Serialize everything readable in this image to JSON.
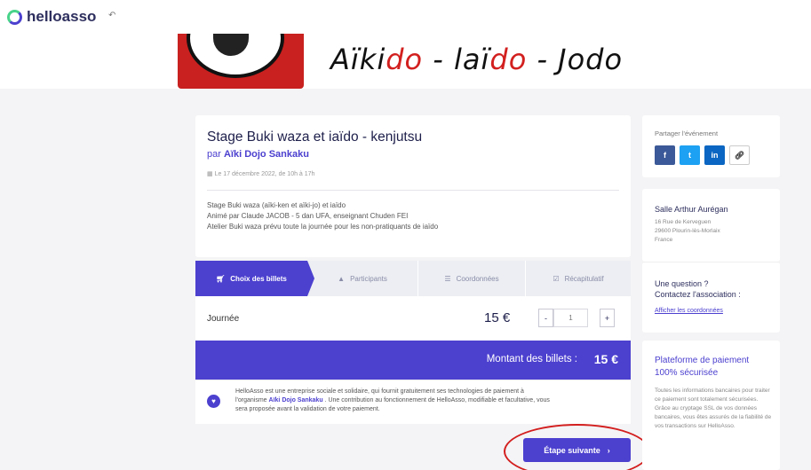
{
  "header": {
    "brand": "helloasso",
    "back_icon": "back-arrow-icon"
  },
  "banner": {
    "title_part1": "Aïki",
    "title_part2": "do",
    "title_sep1": " - ",
    "title_part3": "laï",
    "title_part4": "do",
    "title_sep2": " - ",
    "title_part5": "Jodo"
  },
  "event": {
    "title": "Stage Buki waza et iaïdo - kenjutsu",
    "by_prefix": "par ",
    "organizer": "Aïki Dojo Sankaku",
    "date": "Le 17 décembre 2022, de 10h à 17h",
    "description": [
      "Stage Buki waza (aïki-ken et aïki-jo) et iaïdo",
      "Animé par Claude JACOB - 5 dan UFA, enseignant Chuden FEI",
      "Atelier Buki waza prévu toute la journée pour les non-pratiquants de iaïdo"
    ]
  },
  "steps": [
    {
      "label": "Choix des billets",
      "icon": "cart-icon",
      "active": true
    },
    {
      "label": "Participants",
      "icon": "user-icon",
      "active": false
    },
    {
      "label": "Coordonnées",
      "icon": "list-icon",
      "active": false
    },
    {
      "label": "Récapitulatif",
      "icon": "check-icon",
      "active": false
    }
  ],
  "ticket": {
    "name": "Journée",
    "price": "15 €",
    "quantity": "1",
    "minus": "-",
    "plus": "+"
  },
  "total": {
    "label": "Montant des billets :",
    "value": "15 €"
  },
  "contribution": {
    "line1": "HelloAsso est une entreprise sociale et solidaire, qui fournit gratuitement ses technologies de paiement à",
    "line2_prefix": "l'organisme ",
    "org": "Aïki Dojo Sankaku",
    "line2_suffix": " . Une contribution au fonctionnement de HelloAsso, modifiable et facultative, vous",
    "line3": "sera proposée avant la validation de votre paiement."
  },
  "next_button": {
    "label": "Étape suivante",
    "icon": "chevron-right-icon"
  },
  "share": {
    "label": "Partager l'événement",
    "buttons": [
      {
        "text": "f",
        "name": "facebook-share-button",
        "color": "#3b5998"
      },
      {
        "text": "t",
        "name": "twitter-share-button",
        "color": "#1da1f2"
      },
      {
        "text": "in",
        "name": "linkedin-share-button",
        "color": "#0a66c2"
      },
      {
        "text": "🔗",
        "name": "copy-link-button",
        "color": "#ffffff"
      }
    ]
  },
  "location": {
    "name": "Salle Arthur Aurégan",
    "address": [
      "16 Rue de Kerveguen",
      "29600 Plourin-lès-Morlaix",
      "France"
    ]
  },
  "question": {
    "title_line1": "Une question ?",
    "title_line2": "Contactez l'association :",
    "link": "Afficher les coordonnées"
  },
  "payment": {
    "title_line1": "Plateforme de paiement",
    "title_line2": "100% sécurisée",
    "text": "Toutes les informations bancaires pour traiter ce paiement sont totalement sécurisées. Grâce au cryptage SSL de vos données bancaires, vous êtes assurés de la fiabilité de vos transactions sur HelloAsso."
  },
  "colors": {
    "accent": "#4c40cf",
    "annotation": "#d31e1e"
  }
}
